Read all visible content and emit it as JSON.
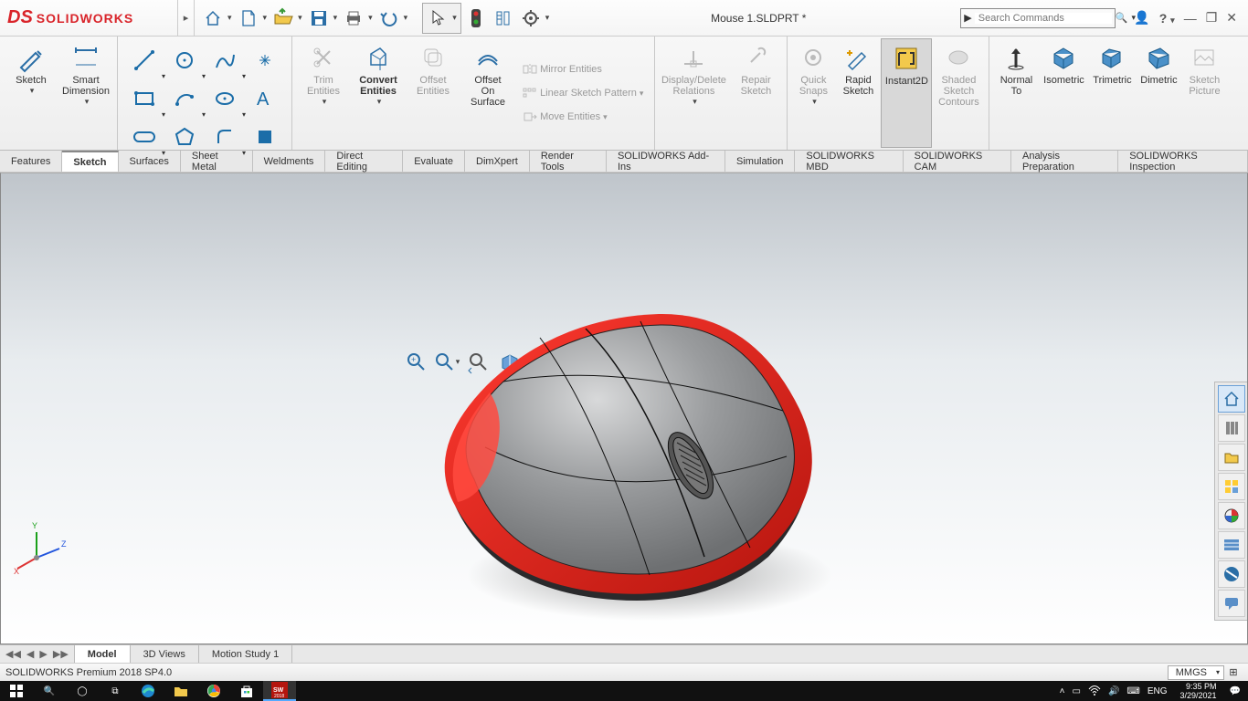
{
  "app": {
    "brand": "SOLIDWORKS",
    "doc_title": "Mouse 1.SLDPRT *",
    "search_placeholder": "Search Commands"
  },
  "ribbon": {
    "sketch": "Sketch",
    "smart_dimension": "Smart\nDimension",
    "trim_entities": "Trim\nEntities",
    "convert_entities": "Convert\nEntities",
    "offset_entities": "Offset\nEntities",
    "offset_on_surface": "Offset\nOn\nSurface",
    "mirror_entities": "Mirror Entities",
    "linear_sketch_pattern": "Linear Sketch Pattern",
    "move_entities": "Move Entities",
    "display_delete_relations": "Display/Delete\nRelations",
    "repair_sketch": "Repair\nSketch",
    "quick_snaps": "Quick\nSnaps",
    "rapid_sketch": "Rapid\nSketch",
    "instant2d": "Instant2D",
    "shaded_sketch_contours": "Shaded\nSketch\nContours",
    "normal_to": "Normal\nTo",
    "isometric": "Isometric",
    "trimetric": "Trimetric",
    "dimetric": "Dimetric",
    "sketch_picture": "Sketch\nPicture"
  },
  "tabs": [
    "Features",
    "Sketch",
    "Surfaces",
    "Sheet Metal",
    "Weldments",
    "Direct Editing",
    "Evaluate",
    "DimXpert",
    "Render Tools",
    "SOLIDWORKS Add-Ins",
    "Simulation",
    "SOLIDWORKS MBD",
    "SOLIDWORKS CAM",
    "Analysis Preparation",
    "SOLIDWORKS Inspection"
  ],
  "active_tab": "Sketch",
  "bottom_tabs": [
    "Model",
    "3D Views",
    "Motion Study 1"
  ],
  "active_bottom_tab": "Model",
  "status": {
    "edition": "SOLIDWORKS Premium 2018 SP4.0",
    "units": "MMGS"
  },
  "taskbar": {
    "lang": "ENG",
    "time": "9:35 PM",
    "date": "3/29/2021"
  }
}
